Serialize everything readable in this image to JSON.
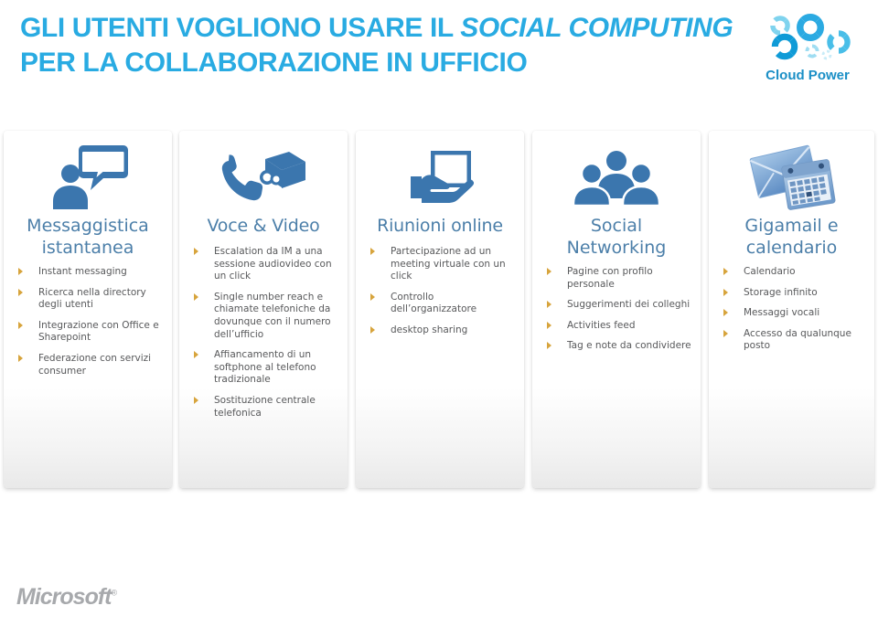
{
  "header": {
    "title_line1_a": "GLI UTENTI VOGLIONO USARE IL ",
    "title_line1_b": "SOCIAL COMPUTING",
    "title_line2": "PER LA COLLABORAZIONE IN UFFICIO",
    "title_color": "#29ABE2",
    "logo": {
      "name": "cloud-power-logo",
      "wordmark": "Cloud Power",
      "color": "#1B8FC6"
    }
  },
  "footer": {
    "brand": "Microsoft",
    "trademark": "®",
    "color": "#A7A9AC"
  },
  "theme": {
    "heading_color": "#4C7FA9",
    "body_color": "#58595B",
    "bullet_color": "#D7A43C",
    "icon_color": "#3B76AE",
    "card_bg": "#FFFFFF"
  },
  "cards": [
    {
      "id": "messaggistica-istantanea",
      "icon": "person-speech-bubble-icon",
      "title": "Messaggistica istantanea",
      "bullets": [
        "Instant messaging",
        "Ricerca nella directory degli utenti",
        "Integrazione con Office e Sharepoint",
        "Federazione con servizi consumer"
      ]
    },
    {
      "id": "voce-e-video",
      "icon": "phone-video-camera-icon",
      "title": "Voce & Video",
      "bullets": [
        "Escalation da IM a una sessione audiovideo con un click",
        "Single number reach e chiamate telefoniche da dovunque con il numero dell’ufficio",
        "Affiancamento di un softphone al telefono tradizionale",
        "Sostituzione centrale telefonica"
      ]
    },
    {
      "id": "riunioni-online",
      "icon": "hand-holding-screen-icon",
      "title": "Riunioni online",
      "bullets": [
        "Partecipazione ad un meeting virtuale con un click",
        "Controllo dell’organizzatore",
        "desktop sharing"
      ]
    },
    {
      "id": "social-networking",
      "icon": "group-of-people-icon",
      "title": "Social Networking",
      "bullets": [
        "Pagine con profilo personale",
        "Suggerimenti dei colleghi",
        "Activities feed",
        "Tag e note da condividere"
      ]
    },
    {
      "id": "gigamail-e-calendario",
      "icon": "envelope-calendar-icon",
      "title": "Gigamail e calendario",
      "bullets": [
        "Calendario",
        "Storage infinito",
        "Messaggi vocali",
        "Accesso da qualunque posto"
      ]
    }
  ]
}
